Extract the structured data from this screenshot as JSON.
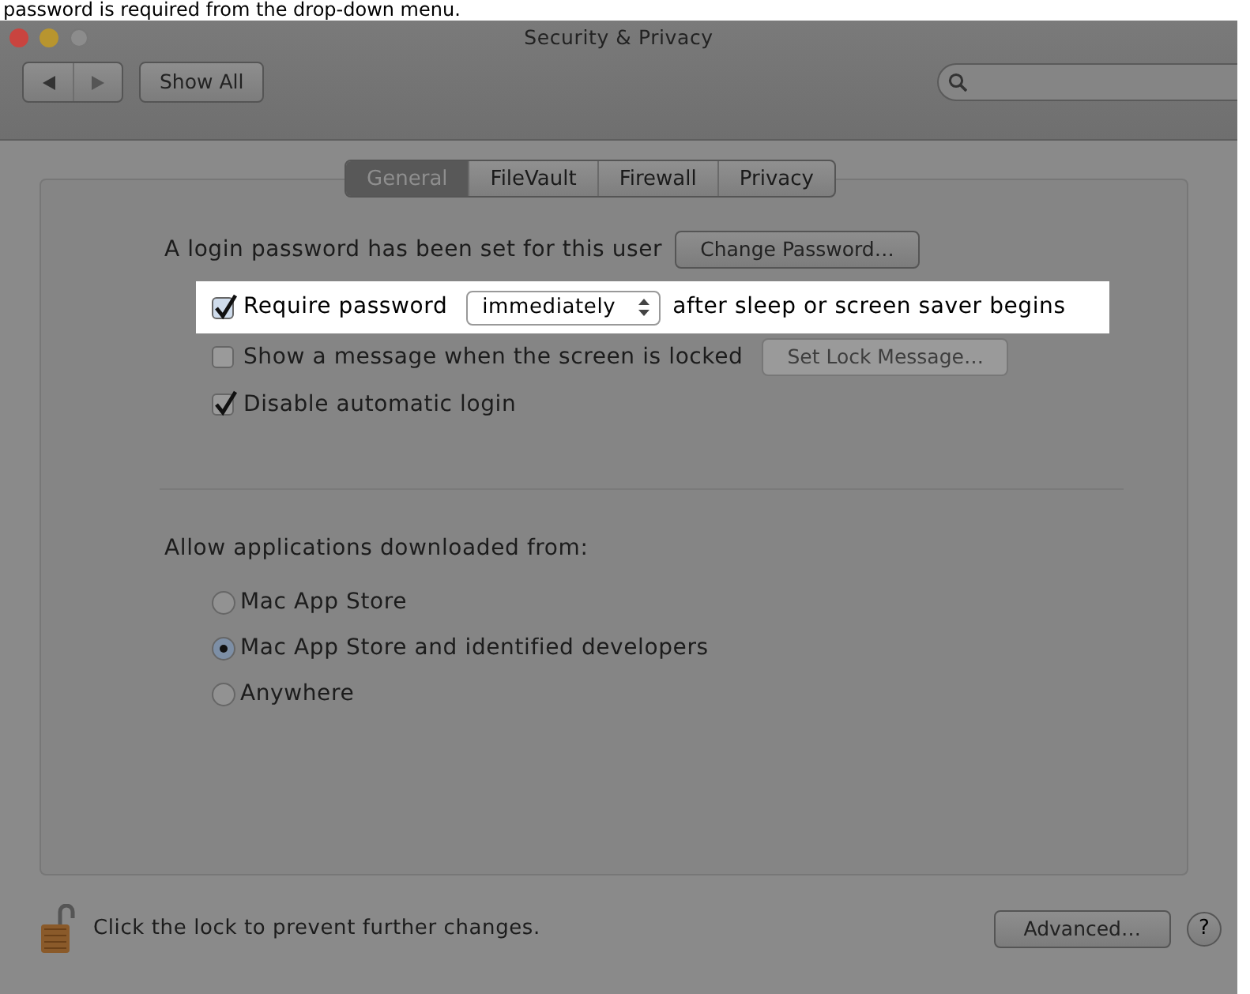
{
  "caption": "password is required from the drop-down menu.",
  "window": {
    "title": "Security & Privacy",
    "show_all": "Show All"
  },
  "tabs": [
    {
      "label": "General",
      "selected": true
    },
    {
      "label": "FileVault",
      "selected": false
    },
    {
      "label": "Firewall",
      "selected": false
    },
    {
      "label": "Privacy",
      "selected": false
    }
  ],
  "login": {
    "text": "A login password has been set for this user",
    "button": "Change Password…"
  },
  "options": [
    {
      "kind": "popup",
      "checked": true,
      "highlighted": true,
      "label": "Require password",
      "value": "immediately",
      "suffix": "after sleep or screen saver begins"
    },
    {
      "kind": "button",
      "checked": false,
      "highlighted": false,
      "label": "Show a message when the screen is locked",
      "button": "Set Lock Message…",
      "button_disabled": true
    },
    {
      "kind": "plain",
      "checked": true,
      "highlighted": false,
      "label": "Disable automatic login"
    }
  ],
  "downloads": {
    "label": "Allow applications downloaded from:",
    "choices": [
      {
        "label": "Mac App Store",
        "selected": false
      },
      {
        "label": "Mac App Store and identified developers",
        "selected": true
      },
      {
        "label": "Anywhere",
        "selected": false
      }
    ]
  },
  "footer": {
    "lock_text": "Click the lock to prevent further changes.",
    "advanced": "Advanced…",
    "help": "?"
  }
}
